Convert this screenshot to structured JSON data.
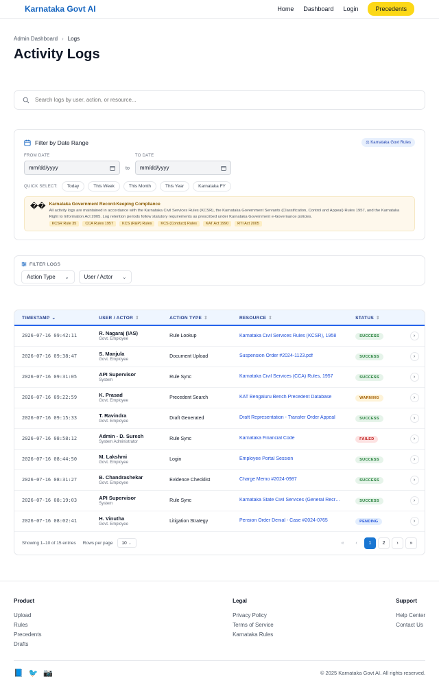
{
  "nav": {
    "brand": "Karnataka Govt AI",
    "links": [
      "Home",
      "Dashboard",
      "Login"
    ],
    "cta": "Precedents"
  },
  "breadcrumb": {
    "parent": "Admin Dashboard",
    "current": "Logs"
  },
  "page_title": "Activity Logs",
  "search": {
    "placeholder": "Search logs by user, action, or resource..."
  },
  "date_filter": {
    "title": "Filter by Date Range",
    "badge": "Karnataka Govt Rules",
    "from_label": "FROM DATE",
    "to_label": "TO DATE",
    "from_value": "mm/dd/yyyy",
    "to_value": "mm/dd/yyyy",
    "to_word": "to",
    "quick_label": "QUICK SELECT:",
    "quick": [
      "Today",
      "This Week",
      "This Month",
      "This Year",
      "Karnataka FY"
    ]
  },
  "notice": {
    "icon": "��",
    "title": "Karnataka Government Record-Keeping Compliance",
    "body": "All activity logs are maintained in accordance with the Karnataka Civil Services Rules (KCSR), the Karnataka Government Servants (Classification, Control and Appeal) Rules 1957, and the Karnataka Right to Information Act 2005. Log retention periods follow statutory requirements as prescribed under Karnataka Government e-Governance policies.",
    "tags": [
      "KCSR Rule 35",
      "CCA Rules 1957",
      "KCS (R&P) Rules",
      "KCS (Conduct) Rules",
      "KAT Act 1990",
      "RTI Act 2005"
    ]
  },
  "filter_logs": {
    "title": "FILTER LOGS",
    "dropdowns": [
      "Action Type",
      "User / Actor"
    ]
  },
  "table": {
    "headers": [
      "TIMESTAMP",
      "USER / ACTOR",
      "ACTION TYPE",
      "RESOURCE",
      "STATUS"
    ],
    "rows": [
      {
        "ts": "2026-07-16 09:42:11",
        "user": "R. Nagaraj (IAS)",
        "role": "Govt. Employee",
        "action": "Rule Lookup",
        "resource": "Karnataka Civil Services Rules (KCSR), 1958",
        "status": "SUCCESS",
        "kind": "success"
      },
      {
        "ts": "2026-07-16 09:38:47",
        "user": "S. Manjula",
        "role": "Govt. Employee",
        "action": "Document Upload",
        "resource": "Suspension Order #2024-1123.pdf",
        "status": "SUCCESS",
        "kind": "success"
      },
      {
        "ts": "2026-07-16 09:31:05",
        "user": "API Supervisor",
        "role": "System",
        "action": "Rule Sync",
        "resource": "Karnataka Civil Services (CCA) Rules, 1957",
        "status": "SUCCESS",
        "kind": "success"
      },
      {
        "ts": "2026-07-16 09:22:59",
        "user": "K. Prasad",
        "role": "Govt. Employee",
        "action": "Precedent Search",
        "resource": "KAT Bengaluru Bench Precedent Database",
        "status": "WARNING",
        "kind": "warning"
      },
      {
        "ts": "2026-07-16 09:15:33",
        "user": "T. Ravindra",
        "role": "Govt. Employee",
        "action": "Draft Generated",
        "resource": "Draft Representation - Transfer Order Appeal",
        "status": "SUCCESS",
        "kind": "success"
      },
      {
        "ts": "2026-07-16 08:58:12",
        "user": "Admin - D. Suresh",
        "role": "System Administrator",
        "action": "Rule Sync",
        "resource": "Karnataka Financial Code",
        "status": "FAILED",
        "kind": "failed"
      },
      {
        "ts": "2026-07-16 08:44:50",
        "user": "M. Lakshmi",
        "role": "Govt. Employee",
        "action": "Login",
        "resource": "Employee Portal Session",
        "status": "SUCCESS",
        "kind": "success"
      },
      {
        "ts": "2026-07-16 08:31:27",
        "user": "B. Chandrashekar",
        "role": "Govt. Employee",
        "action": "Evidence Checklist",
        "resource": "Charge Memo #2024-0987",
        "status": "SUCCESS",
        "kind": "success"
      },
      {
        "ts": "2026-07-16 08:19:03",
        "user": "API Supervisor",
        "role": "System",
        "action": "Rule Sync",
        "resource": "Karnataka State Civil Services (General Recruitment) Rules",
        "status": "SUCCESS",
        "kind": "success"
      },
      {
        "ts": "2026-07-16 08:02:41",
        "user": "H. Vinutha",
        "role": "Govt. Employee",
        "action": "Litigation Strategy",
        "resource": "Pension Order Denial - Case #2024-0765",
        "status": "PENDING",
        "kind": "pending"
      }
    ],
    "showing": "Showing 1–10 of 15 entries",
    "rows_per_page_label": "Rows per page",
    "rows_per_page": "10",
    "pages": [
      "1",
      "2"
    ]
  },
  "footer": {
    "cols": [
      {
        "title": "Product",
        "links": [
          "Upload",
          "Rules",
          "Precedents",
          "Drafts"
        ]
      },
      {
        "title": "Legal",
        "links": [
          "Privacy Policy",
          "Terms of Service",
          "Karnataka Rules"
        ]
      },
      {
        "title": "Support",
        "links": [
          "Help Center",
          "Contact Us"
        ]
      }
    ],
    "social": [
      "📘",
      "🐦",
      "📷"
    ],
    "copyright": "© 2025 Karnataka Govt AI. All rights reserved."
  },
  "colors": {
    "brand": "#1565c0",
    "cta": "#fcd817",
    "accent": "#1976d2"
  }
}
